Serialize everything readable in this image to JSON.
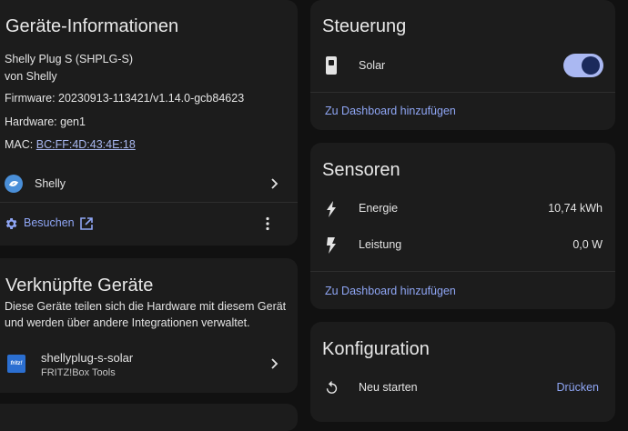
{
  "device_info": {
    "title": "Geräte-Informationen",
    "model": "Shelly Plug S (SHPLG-S)",
    "manufacturer": "von Shelly",
    "firmware_label": "Firmware: ",
    "firmware_value": "20230913-113421/v1.14.0-gcb84623",
    "hardware_label": "Hardware: ",
    "hardware_value": "gen1",
    "mac_label": "MAC: ",
    "mac_value": "BC:FF:4D:43:4E:18",
    "integration_label": "Shelly",
    "visit_label": "Besuchen"
  },
  "linked_devices": {
    "title": "Verknüpfte Geräte",
    "description_line1": "Diese Geräte teilen sich die Hardware mit diesem Gerät",
    "description_line2": "und werden über andere Integrationen verwaltet.",
    "items": [
      {
        "name": "shellyplug-s-solar",
        "subtitle": "FRITZ!Box Tools",
        "logo_text": "fritz!"
      }
    ]
  },
  "controls": {
    "title": "Steuerung",
    "items": [
      {
        "label": "Solar",
        "state": "on"
      }
    ],
    "add_to_dashboard": "Zu Dashboard hinzufügen"
  },
  "sensors": {
    "title": "Sensoren",
    "items": [
      {
        "label": "Energie",
        "value": "10,74 kWh"
      },
      {
        "label": "Leistung",
        "value": "0,0 W"
      }
    ],
    "add_to_dashboard": "Zu Dashboard hinzufügen"
  },
  "configuration": {
    "title": "Konfiguration",
    "items": [
      {
        "label": "Neu starten",
        "action": "Drücken"
      }
    ]
  },
  "colors": {
    "background": "#111111",
    "card": "#1c1c1c",
    "accent": "#8fa6f5",
    "toggle_track": "#aab8f2",
    "toggle_knob": "#1b2a5c"
  }
}
